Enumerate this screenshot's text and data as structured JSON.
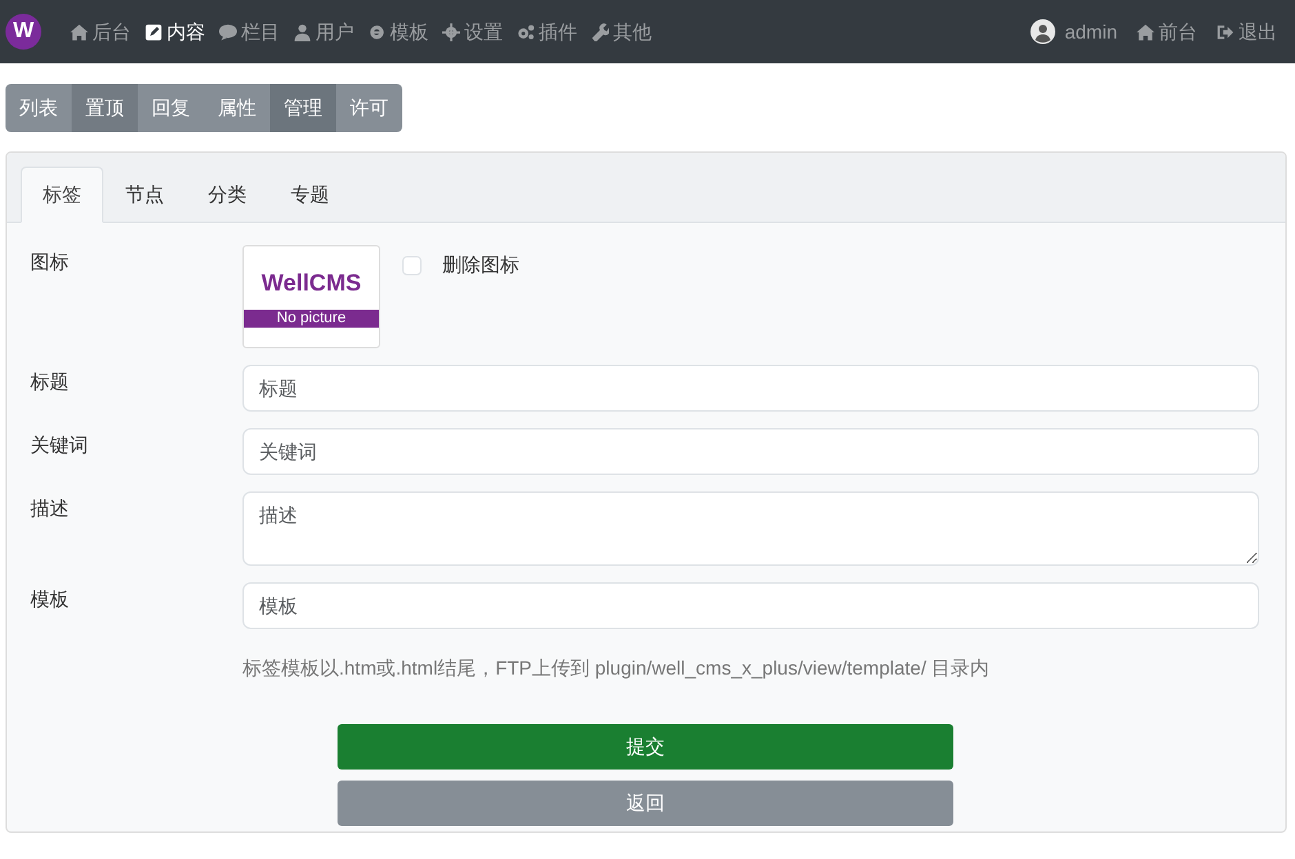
{
  "navbar": {
    "logo": "W",
    "items": [
      {
        "label": "后台",
        "selected": false
      },
      {
        "label": "内容",
        "selected": true
      },
      {
        "label": "栏目",
        "selected": false
      },
      {
        "label": "用户",
        "selected": false
      },
      {
        "label": "模板",
        "selected": false
      },
      {
        "label": "设置",
        "selected": false
      },
      {
        "label": "插件",
        "selected": false
      },
      {
        "label": "其他",
        "selected": false
      }
    ],
    "user": "admin",
    "right_links": [
      "前台",
      "退出"
    ]
  },
  "button_group": [
    {
      "label": "列表",
      "selected": false,
      "hover": false
    },
    {
      "label": "置顶",
      "selected": false,
      "hover": true
    },
    {
      "label": "回复",
      "selected": false,
      "hover": false
    },
    {
      "label": "属性",
      "selected": false,
      "hover": false
    },
    {
      "label": "管理",
      "selected": true,
      "hover": false
    },
    {
      "label": "许可",
      "selected": false,
      "hover": false
    }
  ],
  "tabs": [
    {
      "label": "标签",
      "selected": true
    },
    {
      "label": "节点",
      "selected": false
    },
    {
      "label": "分类",
      "selected": false
    },
    {
      "label": "专题",
      "selected": false
    }
  ],
  "form": {
    "icon_label": "图标",
    "thumbnail": {
      "title": "WellCMS",
      "caption": "No picture"
    },
    "delete_icon": {
      "label": "删除图标",
      "checked": false
    },
    "fields": [
      {
        "kind": "input",
        "label": "标题",
        "placeholder": "标题"
      },
      {
        "kind": "input",
        "label": "关键词",
        "placeholder": "关键词"
      },
      {
        "kind": "textarea",
        "label": "描述",
        "placeholder": "描述"
      },
      {
        "kind": "input",
        "label": "模板",
        "placeholder": "模板"
      }
    ],
    "help": "标签模板以.htm或.html结尾，FTP上传到 plugin/well_cms_x_plus/view/template/ 目录内",
    "buttons": [
      {
        "kind": "primary",
        "label": "提交"
      },
      {
        "kind": "secondary",
        "label": "返回"
      }
    ]
  }
}
